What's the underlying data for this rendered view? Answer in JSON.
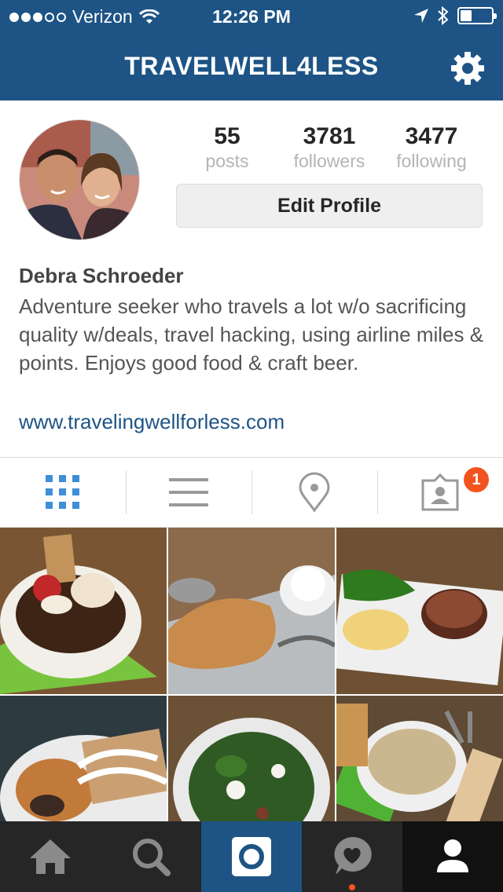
{
  "status_bar": {
    "carrier": "Verizon",
    "time": "12:26 PM"
  },
  "nav": {
    "title": "TRAVELWELL4LESS"
  },
  "profile": {
    "stats": [
      {
        "value": "55",
        "label": "posts"
      },
      {
        "value": "3781",
        "label": "followers"
      },
      {
        "value": "3477",
        "label": "following"
      }
    ],
    "edit_button": "Edit Profile",
    "name": "Debra Schroeder",
    "bio": "Adventure seeker who travels a lot w/o sacrificing quality w/deals, travel hacking, using airline miles & points. Enjoys good food & craft beer.",
    "website": "www.travelingwellforless.com"
  },
  "tabs": {
    "items": [
      "grid-view",
      "list-view",
      "map-view",
      "tagged-photos"
    ],
    "tagged_badge": "1"
  },
  "photos": [
    "dessert-bowl",
    "bread-and-butter",
    "steak-and-polenta",
    "mussels-with-bread",
    "spinach-salad",
    "chowder-with-bread"
  ],
  "bottom_nav": [
    "home",
    "search",
    "camera",
    "activity",
    "profile"
  ],
  "colors": {
    "brand": "#1d5485",
    "badge": "#f3541f",
    "tab_active": "#3f8fd8",
    "bottom_bar": "#262626"
  }
}
